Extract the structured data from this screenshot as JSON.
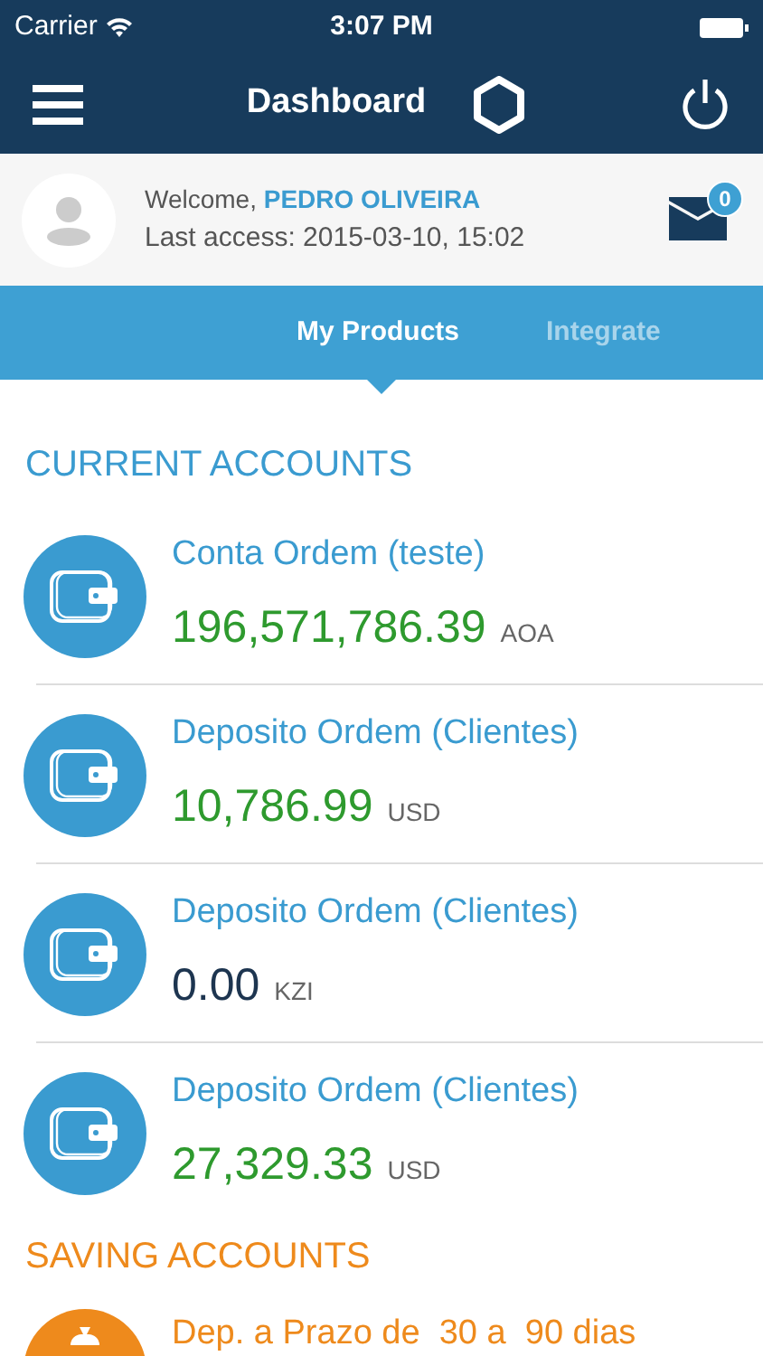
{
  "status_bar": {
    "carrier": "Carrier",
    "time": "3:07 PM"
  },
  "navbar": {
    "title": "Dashboard"
  },
  "user": {
    "greeting": "Welcome,",
    "name": "PEDRO OLIVEIRA",
    "last_access": "Last access: 2015-03-10, 15:02",
    "messages": "0"
  },
  "tabs": [
    {
      "label": "My Products",
      "selected": true
    },
    {
      "label": "Integrate",
      "selected": false
    }
  ],
  "sections": [
    {
      "kind": "current",
      "title": "CURRENT ACCOUNTS",
      "accounts": [
        {
          "name": "Conta Ordem (teste)",
          "amount": "196,571,786.39",
          "currency": "AOA",
          "color": "#2e9a2e"
        },
        {
          "name": "Deposito Ordem (Clientes)",
          "amount": "10,786.99",
          "currency": "USD",
          "color": "#2e9a2e"
        },
        {
          "name": "Deposito Ordem (Clientes)",
          "amount": "0.00",
          "currency": "KZI",
          "color": "#1d3550"
        },
        {
          "name": "Deposito Ordem (Clientes)",
          "amount": "27,329.33",
          "currency": "USD",
          "color": "#2e9a2e"
        }
      ]
    },
    {
      "kind": "saving",
      "title": "SAVING ACCOUNTS",
      "accounts": [
        {
          "name": "Dep. a Prazo de  30 a  90 dias"
        }
      ]
    }
  ]
}
